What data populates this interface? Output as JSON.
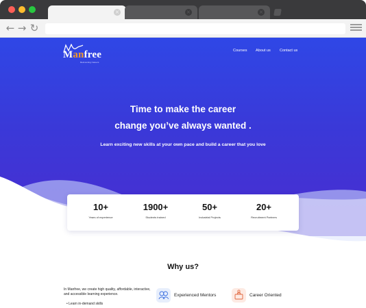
{
  "browser": {
    "tabs": [
      {
        "close": "×"
      },
      {
        "close": "×"
      },
      {
        "close": "×"
      }
    ],
    "nav": {
      "back": "←",
      "forward": "→",
      "reload": "↻"
    }
  },
  "site": {
    "logo": {
      "text_a": "M",
      "text_b": "an",
      "text_c": "free",
      "tagline": "Reinventing Careers"
    },
    "nav": [
      {
        "label": "Courses"
      },
      {
        "label": "About us"
      },
      {
        "label": "Contact us"
      }
    ]
  },
  "hero": {
    "headline_line1": "Time to make the career",
    "headline_line2": "change you’ve always wanted .",
    "subheadline": "Learn exciting new skills at your own pace and build a career that you love"
  },
  "stats": [
    {
      "value": "10+",
      "label": "Years of experience"
    },
    {
      "value": "1900+",
      "label": "Students trained"
    },
    {
      "value": "50+",
      "label": "Industrial Projects"
    },
    {
      "value": "20+",
      "label": "Recruitment Partners"
    }
  ],
  "why": {
    "title": "Why us?",
    "description": "In Manfree, we create high quality, affordable, interactive, and accessible learning experience.",
    "bullets": [
      "Learn in-demand skills"
    ],
    "features": [
      {
        "label": "Experienced Mentors",
        "icon": "mentors-icon"
      },
      {
        "label": "Career Oriented",
        "icon": "career-icon"
      }
    ]
  },
  "colors": {
    "hero_top": "#2f47e6",
    "hero_bottom": "#4a2cd0",
    "logo_accent": "#f39a2c"
  }
}
